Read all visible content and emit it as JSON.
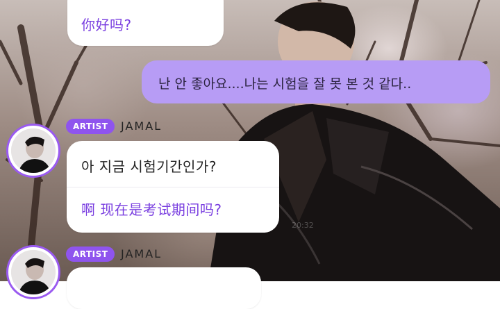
{
  "messages": {
    "first": {
      "text": "你好吗?"
    },
    "outgoing": {
      "text": "난 안 좋아요....나는 시험을 잘 못 본 것 같다.."
    },
    "artist1": {
      "badge": "ARTIST",
      "name": "JAMAL",
      "korean": "아 지금 시험기간인가?",
      "chinese": "啊 现在是考试期间吗?"
    },
    "artist2": {
      "badge": "ARTIST",
      "name": "JAMAL"
    }
  },
  "watermark": "20:32",
  "colors": {
    "accent": "#8f54ee",
    "outgoing_bubble": "#b79cf5",
    "translation_text": "#7a3fe0"
  }
}
